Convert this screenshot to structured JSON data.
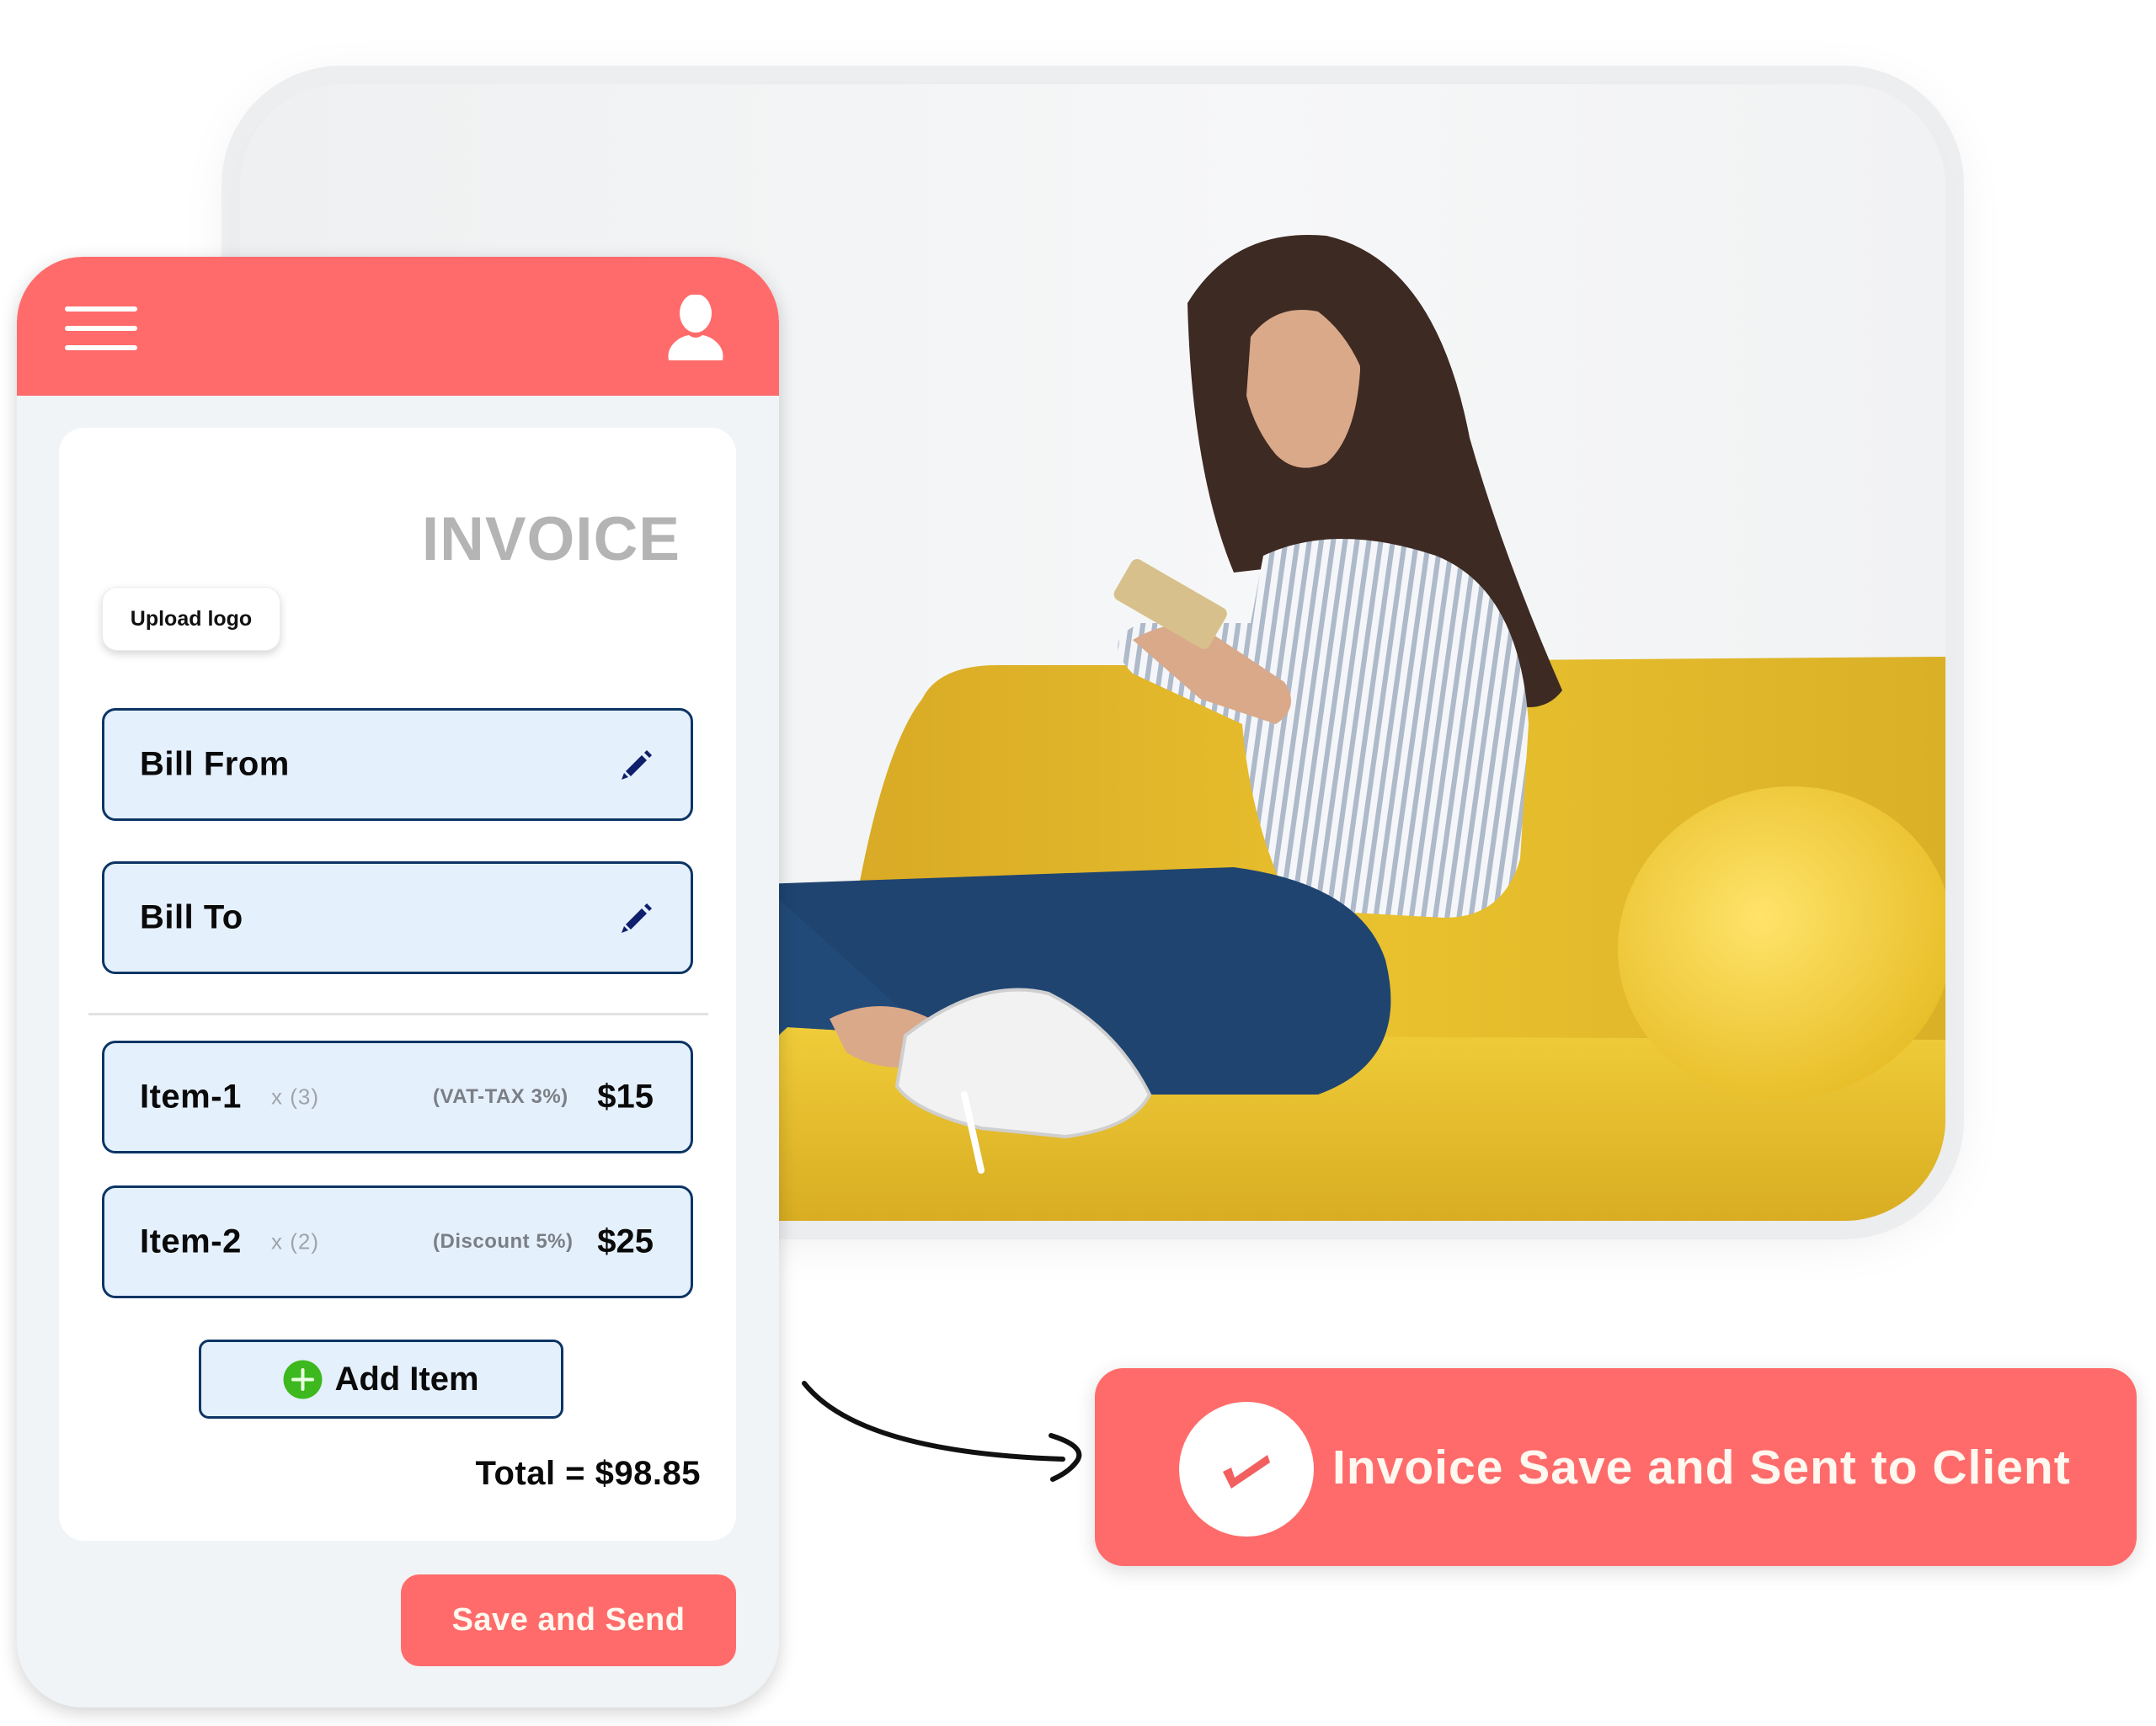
{
  "app": {
    "header": {
      "menu_icon": "hamburger-menu-icon",
      "profile_icon": "user-profile-icon"
    },
    "invoice": {
      "title": "INVOICE",
      "upload_logo_label": "Upload logo",
      "bill_from_label": "Bill From",
      "bill_to_label": "Bill To",
      "edit_icon": "pencil-icon",
      "items": [
        {
          "name": "Item-1",
          "quantity": "x (3)",
          "adjustment": "(VAT-TAX 3%)",
          "price": "$15"
        },
        {
          "name": "Item-2",
          "quantity": "x (2)",
          "adjustment": "(Discount 5%)",
          "price": "$25"
        }
      ],
      "add_item_label": "Add Item",
      "add_item_icon": "plus-circle-icon",
      "total_text": "Total = $98.85",
      "save_send_label": "Save and Send"
    }
  },
  "notification": {
    "icon": "check-circle-icon",
    "message": "Invoice Save and Sent to Client"
  },
  "photo": {
    "description": "Woman sitting on a yellow sofa looking at a phone"
  },
  "colors": {
    "brand_coral": "#FF6B6B",
    "field_border_navy": "#0C3565",
    "field_fill": "#E5F0FD",
    "add_icon_green": "#3DB81E",
    "invoice_title_gray": "#B4B4B4",
    "sofa_yellow": "#E9C12E",
    "jeans_blue": "#1F4470"
  }
}
